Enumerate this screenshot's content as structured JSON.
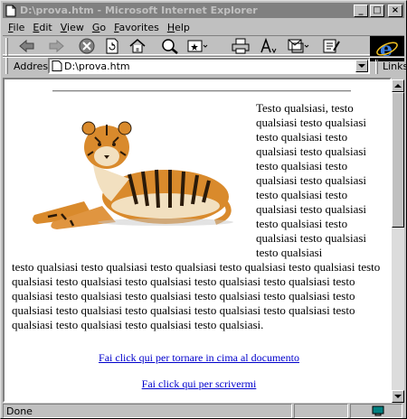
{
  "window": {
    "title": "D:\\prova.htm - Microsoft Internet Explorer",
    "minimize_glyph": "_",
    "maximize_glyph": "□",
    "close_glyph": "×"
  },
  "menu": {
    "items": [
      {
        "label": "File"
      },
      {
        "label": "Edit"
      },
      {
        "label": "View"
      },
      {
        "label": "Go"
      },
      {
        "label": "Favorites"
      },
      {
        "label": "Help"
      }
    ]
  },
  "toolbar": {
    "buttons": [
      "back-icon",
      "forward-icon",
      "stop-icon",
      "refresh-icon",
      "home-icon",
      "search-icon",
      "favorites-icon",
      "print-icon",
      "font-icon",
      "mail-icon",
      "edit-icon"
    ]
  },
  "address": {
    "label": "Address",
    "value": "D:\\prova.htm",
    "links_label": "Links"
  },
  "page": {
    "text_right": "Testo qualsiasi, testo qualsiasi testo qualsiasi testo qualsiasi testo qualsiasi testo qualsiasi testo qualsiasi testo qualsiasi testo qualsiasi testo qualsiasi testo qualsiasi testo qualsiasi testo qualsiasi testo qualsiasi testo qualsiasi testo qualsiasi",
    "text_full": "testo qualsiasi testo qualsiasi testo qualsiasi testo qualsiasi testo qualsiasi testo qualsiasi testo qualsiasi testo qualsiasi testo qualsiasi testo qualsiasi testo qualsiasi testo qualsiasi testo qualsiasi testo qualsiasi testo qualsiasi testo qualsiasi testo qualsiasi testo qualsiasi testo qualsiasi testo qualsiasi testo qualsiasi testo qualsiasi testo qualsiasi testo qualsiasi.",
    "link_top": "Fai click qui per tornare in cima al documento",
    "link_mail": "Fai click qui per scrivermi"
  },
  "status": {
    "text": "Done"
  },
  "colors": {
    "link": "#0000cc",
    "chrome": "#c0c0c0",
    "titlebar_inactive": "#808080"
  }
}
